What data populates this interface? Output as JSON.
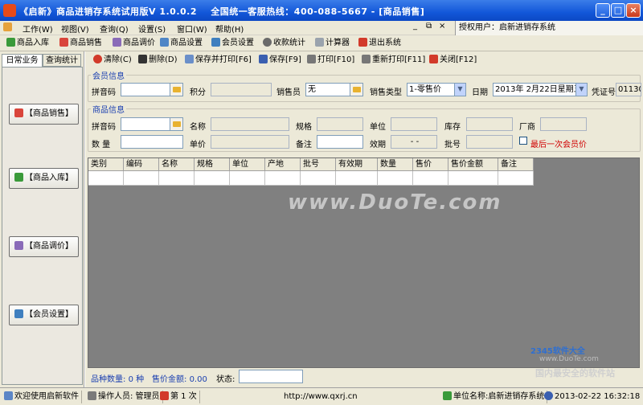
{
  "window": {
    "title": "《启新》商品进销存系统试用版V 1.0.0.2    全国统一客服热线：400-088-5667 - [商品销售]",
    "min_label": "_",
    "max_label": "□",
    "close_label": "×"
  },
  "menu": {
    "items": [
      "工作(W)",
      "视图(V)",
      "查询(Q)",
      "设置(S)",
      "窗口(W)",
      "帮助(H)"
    ],
    "mdi_min": "_",
    "mdi_restore": "⧉",
    "mdi_close": "×",
    "auth_user": "授权用户：启新进销存系统"
  },
  "toolbar": {
    "items": [
      "商品入库",
      "商品销售",
      "商品调价",
      "商品设置",
      "会员设置",
      "收款统计",
      "计算器",
      "退出系统"
    ]
  },
  "left_panel": {
    "tabs": [
      "日常业务",
      "查询统计"
    ],
    "buttons": [
      "【商品销售】",
      "【商品入库】",
      "【商品调价】",
      "【会员设置】"
    ]
  },
  "actions": {
    "items": [
      "清除(C)",
      "删除(D)",
      "保存并打印[F6]",
      "保存[F9]",
      "打印[F10]",
      "重新打印[F11]",
      "关闭[F12]"
    ]
  },
  "member_info": {
    "section_title": "会员信息",
    "pinyin_label": "拼音码",
    "pinyin_value": "",
    "points_label": "积分",
    "points_value": "",
    "seller_label": "销售员",
    "seller_value": "无",
    "sale_type_label": "销售类型",
    "sale_type_value": "1-零售价",
    "date_label": "日期",
    "date_value": "2013年 2月22日星期五",
    "voucher_label": "凭证号",
    "voucher_value": "01130"
  },
  "product_info": {
    "section_title": "商品信息",
    "pinyin_label": "拼音码",
    "name_label": "名称",
    "spec_label": "规格",
    "unit_label": "单位",
    "stock_label": "库存",
    "maker_label": "厂商",
    "qty_label": "数  量",
    "price_label": "单价",
    "note_label": "备注",
    "expiry_label": "效期",
    "expiry_value": "- -",
    "batch_label": "批号",
    "last_member_price_label": "最后一次会员价"
  },
  "grid": {
    "columns": [
      "类别",
      "编码",
      "名称",
      "规格",
      "单位",
      "产地",
      "批号",
      "有效期",
      "数量",
      "售价",
      "售价金额",
      "备注"
    ],
    "watermark": "www.DuoTe.com"
  },
  "summary": {
    "kinds_label": "品种数量:",
    "kinds_value": "0 种",
    "amount_label": "售价金额:",
    "amount_value": "0.00",
    "status_label": "状态:"
  },
  "status_bar": {
    "welcome": "欢迎使用启新软件",
    "operator": "操作人员: 管理员",
    "shift": "第 1 次",
    "url": "http://www.qxrj.cn",
    "company": "单位名称:启新进销存系统",
    "datetime": "2013-02-22 16:32:18"
  },
  "branding": {
    "line1": "2345软件大全",
    "line2": "国内最安全的软件站",
    "site": "www.DuoTe.com"
  },
  "colors": {
    "title_blue": "#1257d9",
    "section_blue": "#1a3fb0",
    "red_text": "#d00000"
  }
}
